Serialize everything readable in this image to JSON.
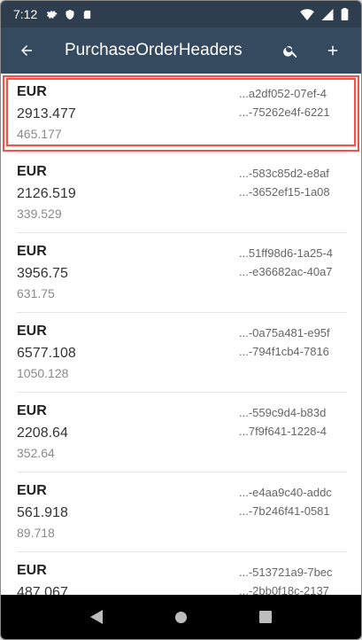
{
  "status_bar": {
    "time": "7:12",
    "left_icons": [
      "gear-icon",
      "shield-icon",
      "sd-card-icon"
    ],
    "right_icons": [
      "wifi-icon",
      "signal-icon",
      "battery-icon"
    ]
  },
  "app_bar": {
    "title": "PurchaseOrderHeaders",
    "actions": [
      "search-icon",
      "add-icon"
    ]
  },
  "rows": [
    {
      "currency": "EUR",
      "amount": "2913.477",
      "tax": "465.177",
      "id1": "a2df052-07ef-4...",
      "id2": "75262e4f-6221-...",
      "selected": true
    },
    {
      "currency": "EUR",
      "amount": "2126.519",
      "tax": "339.529",
      "id1": "583c85d2-e8af-...",
      "id2": "3652ef15-1a08-..."
    },
    {
      "currency": "EUR",
      "amount": "3956.75",
      "tax": "631.75",
      "id1": "51ff98d6-1a25-4...",
      "id2": "e36682ac-40a7-..."
    },
    {
      "currency": "EUR",
      "amount": "6577.108",
      "tax": "1050.128",
      "id1": "0a75a481-e95f-...",
      "id2": "794f1cb4-7816-..."
    },
    {
      "currency": "EUR",
      "amount": "2208.64",
      "tax": "352.64",
      "id1": "559c9d4-b83d-...",
      "id2": "7f9f641-1228-4..."
    },
    {
      "currency": "EUR",
      "amount": "561.918",
      "tax": "89.718",
      "id1": "e4aa9c40-addc-...",
      "id2": "7b246f41-0581-..."
    },
    {
      "currency": "EUR",
      "amount": "487.067",
      "tax": "",
      "id1": "513721a9-7bec-...",
      "id2": "2bb0f18c-2137-..."
    }
  ],
  "colors": {
    "status_bar": "#2f3e4e",
    "app_bar": "#354a5f",
    "highlight": "#e8574a"
  }
}
